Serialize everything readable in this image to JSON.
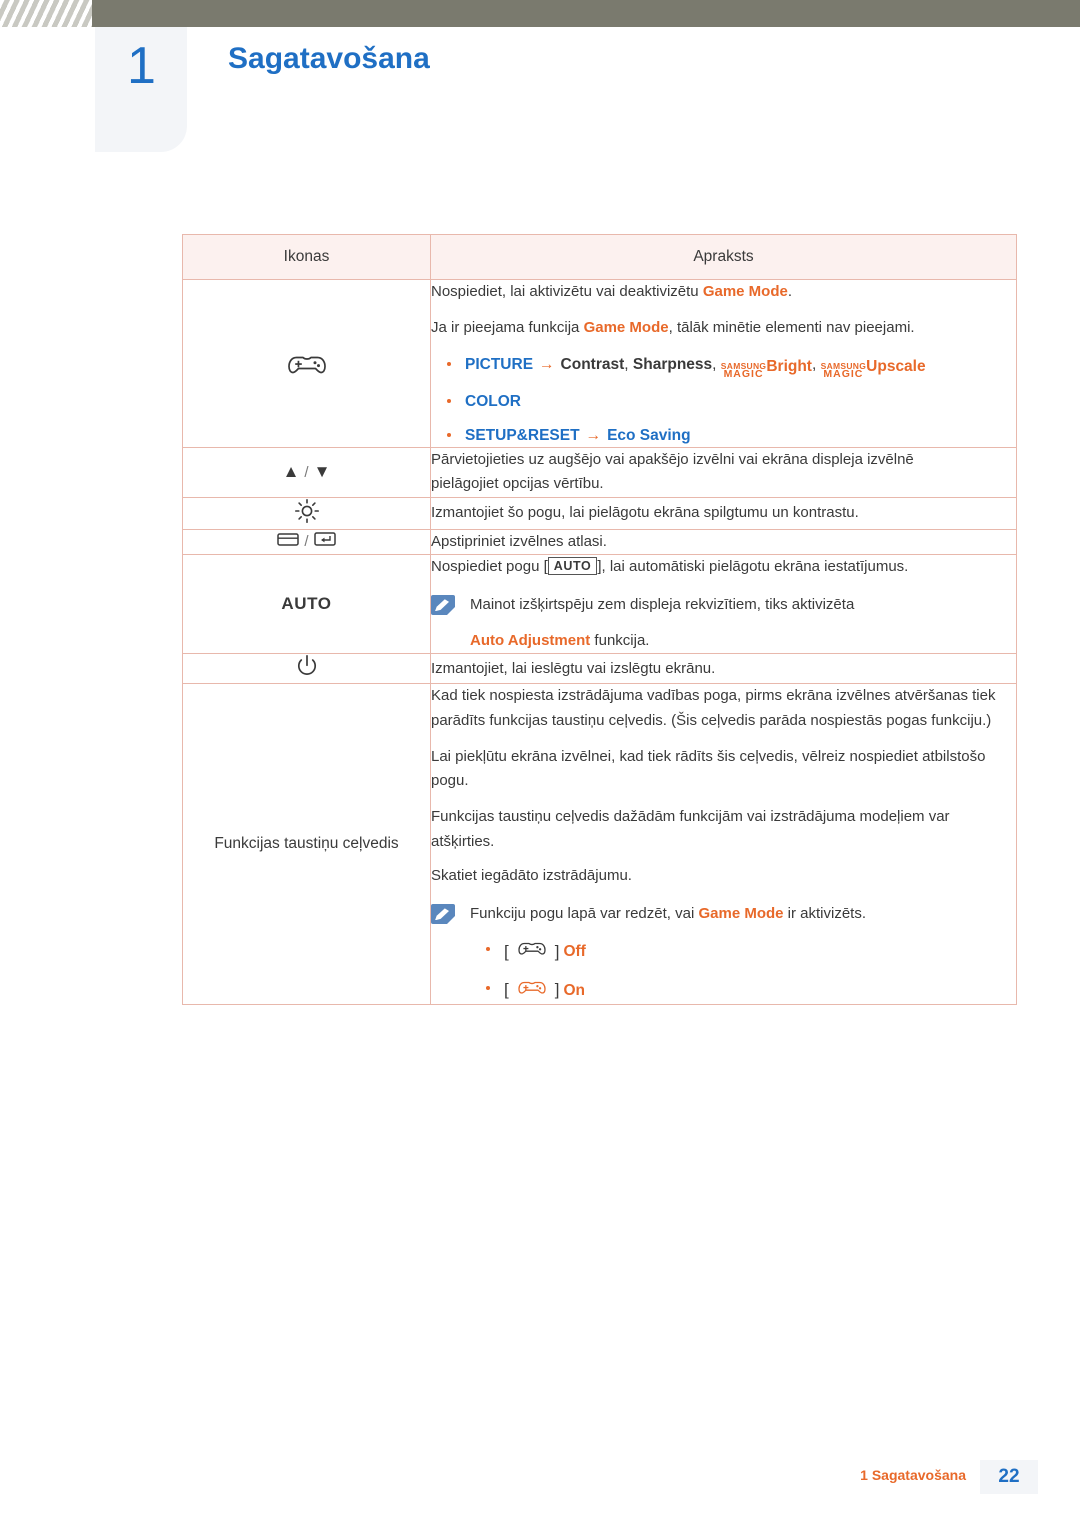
{
  "header": {
    "chapter_number": "1",
    "chapter_title": "Sagatavošana"
  },
  "table": {
    "columns": [
      "Ikonas",
      "Apraksts"
    ],
    "rows": [
      {
        "icon_name": "gamepad-icon",
        "icon_text": "",
        "desc": {
          "line1_a": "Nospiediet, lai aktivizētu vai deaktivizētu ",
          "line1_b": "Game Mode",
          "line1_c": ".",
          "line2_a": "Ja ir pieejama funkcija ",
          "line2_b": "Game Mode",
          "line2_c": ", tālāk minētie elementi nav pieejami.",
          "bullets": [
            {
              "label": "PICTURE",
              "arrow": "→",
              "rest_1": "Contrast",
              "rest_sep": ", ",
              "rest_2": "Sharpness",
              "magic_top": "SAMSUNG",
              "magic_bottom": "MAGIC",
              "magic_word_1": "Bright",
              "magic_word_2": "Upscale"
            },
            {
              "label": "COLOR"
            },
            {
              "label": "SETUP&RESET",
              "arrow": "→",
              "rest_1": "Eco Saving"
            }
          ]
        }
      },
      {
        "icon_name": "up-down-arrows-icon",
        "icon_up": "▲",
        "icon_sep": "/",
        "icon_down": "▼",
        "desc_p1": "Pārvietojieties uz augšējo vai apakšējo izvēlni vai ekrāna displeja izvēlnē",
        "desc_p2": "pielāgojiet opcijas vērtību."
      },
      {
        "icon_name": "brightness-icon",
        "desc_p1": "Izmantojiet šo pogu, lai pielāgotu ekrāna spilgtumu un kontrastu."
      },
      {
        "icon_name": "enter-back-icon",
        "icon_sep": "/",
        "desc_p1": "Apstipriniet izvēlnes atlasi."
      },
      {
        "icon_name": "auto-button",
        "icon_text": "AUTO",
        "desc_p1_a": "Nospiediet pogu [",
        "desc_p1_key": "AUTO",
        "desc_p1_b": "], lai automātiski pielāgotu ekrāna iestatījumus.",
        "note": {
          "line1": "Mainot izšķirtspēju zem displeja rekvizītiem, tiks aktivizēta",
          "line2_a": "Auto Adjustment",
          "line2_b": " funkcija."
        }
      },
      {
        "icon_name": "power-icon",
        "desc_p1": "Izmantojiet, lai ieslēgtu vai izslēgtu ekrānu."
      },
      {
        "icon_name": "function-key-guide-label",
        "icon_text": "Funkcijas taustiņu ceļvedis",
        "desc_p1": "Kad tiek nospiesta izstrādājuma vadības poga, pirms ekrāna izvēlnes atvēršanas tiek parādīts funkcijas taustiņu ceļvedis. (Šis ceļvedis parāda nospiestās pogas funkciju.)",
        "desc_p2": "Lai piekļūtu ekrāna izvēlnei, kad tiek rādīts šis ceļvedis, vēlreiz nospiediet atbilstošo pogu.",
        "desc_p3": "Funkcijas taustiņu ceļvedis dažādām funkcijām vai izstrādājuma modeļiem var atšķirties.",
        "desc_p4": "Skatiet iegādāto izstrādājumu.",
        "note": {
          "line1_a": "Funkciju pogu lapā var redzēt, vai ",
          "line1_b": "Game Mode",
          "line1_c": " ir aktivizēts.",
          "items": [
            {
              "bracket_open": "[",
              "bracket_close": "]",
              "state": "Off"
            },
            {
              "bracket_open": "[",
              "bracket_close": "]",
              "state": "On"
            }
          ]
        }
      }
    ]
  },
  "footer": {
    "text": "1 Sagatavošana",
    "page": "22"
  },
  "colors": {
    "accent_orange": "#e8692a",
    "accent_blue": "#1f6fc4",
    "table_border": "#e8b8ac",
    "header_bar": "#7a7a6e"
  }
}
